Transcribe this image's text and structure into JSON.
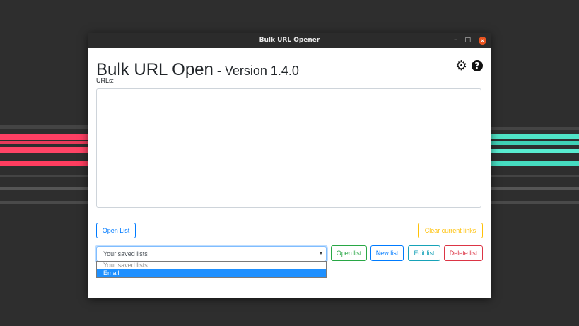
{
  "window": {
    "title": "Bulk URL Opener",
    "controls": {
      "minimize": "–",
      "maximize": "□",
      "close": "×"
    }
  },
  "header": {
    "title_main": "Bulk URL Open",
    "title_version": " - Version 1.4.0",
    "icons": [
      "gear-icon",
      "help-icon"
    ]
  },
  "urls": {
    "label": "URLs:",
    "value": ""
  },
  "buttons": {
    "open_list": "Open List",
    "clear_current": "Clear current links",
    "open": "Open list",
    "new": "New list",
    "edit": "Edit list",
    "delete": "Delete list"
  },
  "saved_lists": {
    "selected": "Your saved lists",
    "options": [
      {
        "label": "Your saved lists",
        "disabled": true
      },
      {
        "label": "Email",
        "highlighted": true
      }
    ]
  },
  "colors": {
    "primary": "#007bff",
    "warning": "#ffc107",
    "success": "#28a745",
    "info": "#17a2b8",
    "danger": "#dc3545",
    "highlight": "#1e90ff",
    "titlebar": "#2b2b2b"
  }
}
